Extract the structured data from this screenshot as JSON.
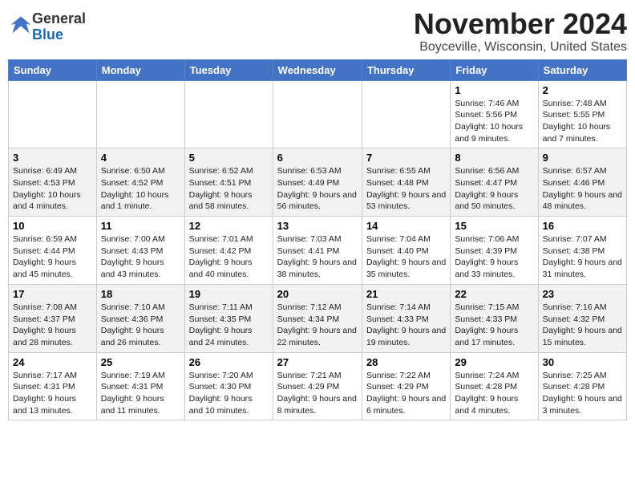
{
  "logo": {
    "general": "General",
    "blue": "Blue"
  },
  "header": {
    "month": "November 2024",
    "location": "Boyceville, Wisconsin, United States"
  },
  "weekdays": [
    "Sunday",
    "Monday",
    "Tuesday",
    "Wednesday",
    "Thursday",
    "Friday",
    "Saturday"
  ],
  "weeks": [
    [
      {
        "day": "",
        "info": ""
      },
      {
        "day": "",
        "info": ""
      },
      {
        "day": "",
        "info": ""
      },
      {
        "day": "",
        "info": ""
      },
      {
        "day": "",
        "info": ""
      },
      {
        "day": "1",
        "info": "Sunrise: 7:46 AM\nSunset: 5:56 PM\nDaylight: 10 hours and 9 minutes."
      },
      {
        "day": "2",
        "info": "Sunrise: 7:48 AM\nSunset: 5:55 PM\nDaylight: 10 hours and 7 minutes."
      }
    ],
    [
      {
        "day": "3",
        "info": "Sunrise: 6:49 AM\nSunset: 4:53 PM\nDaylight: 10 hours and 4 minutes."
      },
      {
        "day": "4",
        "info": "Sunrise: 6:50 AM\nSunset: 4:52 PM\nDaylight: 10 hours and 1 minute."
      },
      {
        "day": "5",
        "info": "Sunrise: 6:52 AM\nSunset: 4:51 PM\nDaylight: 9 hours and 58 minutes."
      },
      {
        "day": "6",
        "info": "Sunrise: 6:53 AM\nSunset: 4:49 PM\nDaylight: 9 hours and 56 minutes."
      },
      {
        "day": "7",
        "info": "Sunrise: 6:55 AM\nSunset: 4:48 PM\nDaylight: 9 hours and 53 minutes."
      },
      {
        "day": "8",
        "info": "Sunrise: 6:56 AM\nSunset: 4:47 PM\nDaylight: 9 hours and 50 minutes."
      },
      {
        "day": "9",
        "info": "Sunrise: 6:57 AM\nSunset: 4:46 PM\nDaylight: 9 hours and 48 minutes."
      }
    ],
    [
      {
        "day": "10",
        "info": "Sunrise: 6:59 AM\nSunset: 4:44 PM\nDaylight: 9 hours and 45 minutes."
      },
      {
        "day": "11",
        "info": "Sunrise: 7:00 AM\nSunset: 4:43 PM\nDaylight: 9 hours and 43 minutes."
      },
      {
        "day": "12",
        "info": "Sunrise: 7:01 AM\nSunset: 4:42 PM\nDaylight: 9 hours and 40 minutes."
      },
      {
        "day": "13",
        "info": "Sunrise: 7:03 AM\nSunset: 4:41 PM\nDaylight: 9 hours and 38 minutes."
      },
      {
        "day": "14",
        "info": "Sunrise: 7:04 AM\nSunset: 4:40 PM\nDaylight: 9 hours and 35 minutes."
      },
      {
        "day": "15",
        "info": "Sunrise: 7:06 AM\nSunset: 4:39 PM\nDaylight: 9 hours and 33 minutes."
      },
      {
        "day": "16",
        "info": "Sunrise: 7:07 AM\nSunset: 4:38 PM\nDaylight: 9 hours and 31 minutes."
      }
    ],
    [
      {
        "day": "17",
        "info": "Sunrise: 7:08 AM\nSunset: 4:37 PM\nDaylight: 9 hours and 28 minutes."
      },
      {
        "day": "18",
        "info": "Sunrise: 7:10 AM\nSunset: 4:36 PM\nDaylight: 9 hours and 26 minutes."
      },
      {
        "day": "19",
        "info": "Sunrise: 7:11 AM\nSunset: 4:35 PM\nDaylight: 9 hours and 24 minutes."
      },
      {
        "day": "20",
        "info": "Sunrise: 7:12 AM\nSunset: 4:34 PM\nDaylight: 9 hours and 22 minutes."
      },
      {
        "day": "21",
        "info": "Sunrise: 7:14 AM\nSunset: 4:33 PM\nDaylight: 9 hours and 19 minutes."
      },
      {
        "day": "22",
        "info": "Sunrise: 7:15 AM\nSunset: 4:33 PM\nDaylight: 9 hours and 17 minutes."
      },
      {
        "day": "23",
        "info": "Sunrise: 7:16 AM\nSunset: 4:32 PM\nDaylight: 9 hours and 15 minutes."
      }
    ],
    [
      {
        "day": "24",
        "info": "Sunrise: 7:17 AM\nSunset: 4:31 PM\nDaylight: 9 hours and 13 minutes."
      },
      {
        "day": "25",
        "info": "Sunrise: 7:19 AM\nSunset: 4:31 PM\nDaylight: 9 hours and 11 minutes."
      },
      {
        "day": "26",
        "info": "Sunrise: 7:20 AM\nSunset: 4:30 PM\nDaylight: 9 hours and 10 minutes."
      },
      {
        "day": "27",
        "info": "Sunrise: 7:21 AM\nSunset: 4:29 PM\nDaylight: 9 hours and 8 minutes."
      },
      {
        "day": "28",
        "info": "Sunrise: 7:22 AM\nSunset: 4:29 PM\nDaylight: 9 hours and 6 minutes."
      },
      {
        "day": "29",
        "info": "Sunrise: 7:24 AM\nSunset: 4:28 PM\nDaylight: 9 hours and 4 minutes."
      },
      {
        "day": "30",
        "info": "Sunrise: 7:25 AM\nSunset: 4:28 PM\nDaylight: 9 hours and 3 minutes."
      }
    ]
  ]
}
